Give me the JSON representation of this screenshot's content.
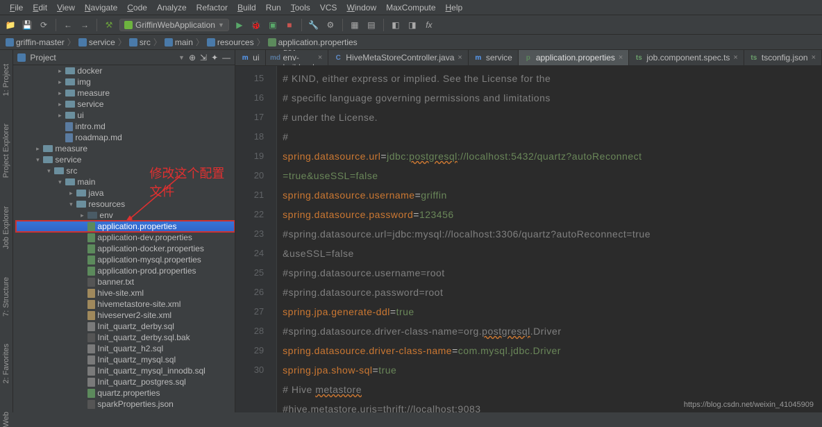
{
  "menu": [
    "File",
    "Edit",
    "View",
    "Navigate",
    "Code",
    "Analyze",
    "Refactor",
    "Build",
    "Run",
    "Tools",
    "VCS",
    "Window",
    "MaxCompute",
    "Help"
  ],
  "menu_underline": [
    0,
    0,
    0,
    0,
    0,
    -1,
    -1,
    0,
    -1,
    0,
    -1,
    0,
    -1,
    0
  ],
  "runconfig": {
    "name": "GriffinWebApplication"
  },
  "breadcrumb": [
    "griffin-master",
    "service",
    "src",
    "main",
    "resources",
    "application.properties"
  ],
  "project_label": "Project",
  "sideTabs": [
    "1: Project",
    "Project Explorer",
    "Job Explorer",
    "7: Structure",
    "2: Favorites",
    "Web"
  ],
  "tree": [
    {
      "d": 3,
      "a": "closed",
      "i": "fold",
      "t": "docker"
    },
    {
      "d": 3,
      "a": "closed",
      "i": "fold",
      "t": "img"
    },
    {
      "d": 3,
      "a": "closed",
      "i": "fold",
      "t": "measure"
    },
    {
      "d": 3,
      "a": "closed",
      "i": "fold",
      "t": "service"
    },
    {
      "d": 3,
      "a": "closed",
      "i": "fold",
      "t": "ui"
    },
    {
      "d": 3,
      "a": "none",
      "i": "md",
      "t": "intro.md"
    },
    {
      "d": 3,
      "a": "none",
      "i": "md",
      "t": "roadmap.md"
    },
    {
      "d": 1,
      "a": "closed",
      "i": "fold",
      "t": "measure"
    },
    {
      "d": 1,
      "a": "open",
      "i": "fold",
      "t": "service"
    },
    {
      "d": 2,
      "a": "open",
      "i": "fold",
      "t": "src"
    },
    {
      "d": 3,
      "a": "open",
      "i": "fold",
      "t": "main"
    },
    {
      "d": 4,
      "a": "closed",
      "i": "fold",
      "t": "java"
    },
    {
      "d": 4,
      "a": "open",
      "i": "fold",
      "t": "resources"
    },
    {
      "d": 5,
      "a": "closed",
      "i": "foldl",
      "t": "env"
    },
    {
      "d": 5,
      "a": "none",
      "i": "props",
      "t": "application.properties",
      "sel": true
    },
    {
      "d": 5,
      "a": "none",
      "i": "props",
      "t": "application-dev.properties"
    },
    {
      "d": 5,
      "a": "none",
      "i": "props",
      "t": "application-docker.properties"
    },
    {
      "d": 5,
      "a": "none",
      "i": "props",
      "t": "application-mysql.properties"
    },
    {
      "d": 5,
      "a": "none",
      "i": "props",
      "t": "application-prod.properties"
    },
    {
      "d": 5,
      "a": "none",
      "i": "file",
      "t": "banner.txt"
    },
    {
      "d": 5,
      "a": "none",
      "i": "xml",
      "t": "hive-site.xml"
    },
    {
      "d": 5,
      "a": "none",
      "i": "xml",
      "t": "hivemetastore-site.xml"
    },
    {
      "d": 5,
      "a": "none",
      "i": "xml",
      "t": "hiveserver2-site.xml"
    },
    {
      "d": 5,
      "a": "none",
      "i": "sql",
      "t": "Init_quartz_derby.sql"
    },
    {
      "d": 5,
      "a": "none",
      "i": "file",
      "t": "Init_quartz_derby.sql.bak"
    },
    {
      "d": 5,
      "a": "none",
      "i": "sql",
      "t": "Init_quartz_h2.sql"
    },
    {
      "d": 5,
      "a": "none",
      "i": "sql",
      "t": "Init_quartz_mysql.sql"
    },
    {
      "d": 5,
      "a": "none",
      "i": "sql",
      "t": "Init_quartz_mysql_innodb.sql"
    },
    {
      "d": 5,
      "a": "none",
      "i": "sql",
      "t": "Init_quartz_postgres.sql"
    },
    {
      "d": 5,
      "a": "none",
      "i": "props",
      "t": "quartz.properties"
    },
    {
      "d": 5,
      "a": "none",
      "i": "file",
      "t": "sparkProperties.json"
    }
  ],
  "annotation_text": "修改这个配置文件",
  "tabs": [
    {
      "icon": "m",
      "color": "#589df6",
      "label": "ui",
      "active": false
    },
    {
      "icon": "md",
      "color": "#5a7ba0",
      "label": "dev-env-build.md",
      "active": false,
      "close": true
    },
    {
      "icon": "C",
      "color": "#5f8cc9",
      "label": "HiveMetaStoreController.java",
      "active": false,
      "close": true
    },
    {
      "icon": "m",
      "color": "#589df6",
      "label": "service",
      "active": false
    },
    {
      "icon": "p",
      "color": "#5c8a5c",
      "label": "application.properties",
      "active": true,
      "close": true
    },
    {
      "icon": "ts",
      "color": "#6b9f6b",
      "label": "job.component.spec.ts",
      "active": false,
      "close": true
    },
    {
      "icon": "ts",
      "color": "#6b9f6b",
      "label": "tsconfig.json",
      "active": false,
      "close": true
    }
  ],
  "gutter": [
    15,
    16,
    17,
    18,
    19,
    "",
    20,
    21,
    22,
    "",
    23,
    24,
    25,
    26,
    27,
    28,
    29,
    30
  ],
  "code": [
    [
      {
        "c": "c",
        "t": "# KIND, either express or implied.  See the License for the"
      }
    ],
    [
      {
        "c": "c",
        "t": "# specific language governing permissions and limitations"
      }
    ],
    [
      {
        "c": "c",
        "t": "# under the License."
      }
    ],
    [
      {
        "c": "c",
        "t": "#"
      }
    ],
    [
      {
        "c": "k",
        "t": "spring.datasource.url"
      },
      {
        "c": "",
        "t": "="
      },
      {
        "c": "v",
        "t": "jdbc:"
      },
      {
        "c": "lnk",
        "t": "postgresql"
      },
      {
        "c": "v",
        "t": "://localhost:5432/quartz?autoReconnect"
      }
    ],
    [
      {
        "c": "v",
        "t": " =true&useSSL=false"
      }
    ],
    [
      {
        "c": "k",
        "t": "spring.datasource.username"
      },
      {
        "c": "",
        "t": "="
      },
      {
        "c": "v",
        "t": "griffin"
      }
    ],
    [
      {
        "c": "k",
        "t": "spring.datasource.password"
      },
      {
        "c": "",
        "t": "="
      },
      {
        "c": "v",
        "t": "123456"
      }
    ],
    [
      {
        "c": "c",
        "t": "#spring.datasource.url=jdbc:mysql://localhost:3306/quartz?autoReconnect=true"
      }
    ],
    [
      {
        "c": "c",
        "t": " &useSSL=false"
      }
    ],
    [
      {
        "c": "c",
        "t": "#spring.datasource.username=root"
      }
    ],
    [
      {
        "c": "c",
        "t": "#spring.datasource.password=root"
      }
    ],
    [
      {
        "c": "k",
        "t": "spring.jpa.generate-ddl"
      },
      {
        "c": "",
        "t": "="
      },
      {
        "c": "v",
        "t": "true"
      }
    ],
    [
      {
        "c": "c",
        "t": "#spring.datasource.driver-class-name=org."
      },
      {
        "c": "cu",
        "t": "postgresql"
      },
      {
        "c": "c",
        "t": ".Driver"
      }
    ],
    [
      {
        "c": "k",
        "t": "spring.datasource.driver-class-name"
      },
      {
        "c": "",
        "t": "="
      },
      {
        "c": "v",
        "t": "com.mysql.jdbc.Driver"
      }
    ],
    [
      {
        "c": "k",
        "t": "spring.jpa.show-sql"
      },
      {
        "c": "",
        "t": "="
      },
      {
        "c": "v",
        "t": "true"
      }
    ],
    [
      {
        "c": "c",
        "t": "# Hive "
      },
      {
        "c": "cu",
        "t": "metastore"
      }
    ],
    [
      {
        "c": "c",
        "t": "#hive."
      },
      {
        "c": "cu",
        "t": "metastore"
      },
      {
        "c": "c",
        "t": ".uris=thrift://localhost:9083"
      }
    ]
  ],
  "watermark": "https://blog.csdn.net/weixin_41045909"
}
